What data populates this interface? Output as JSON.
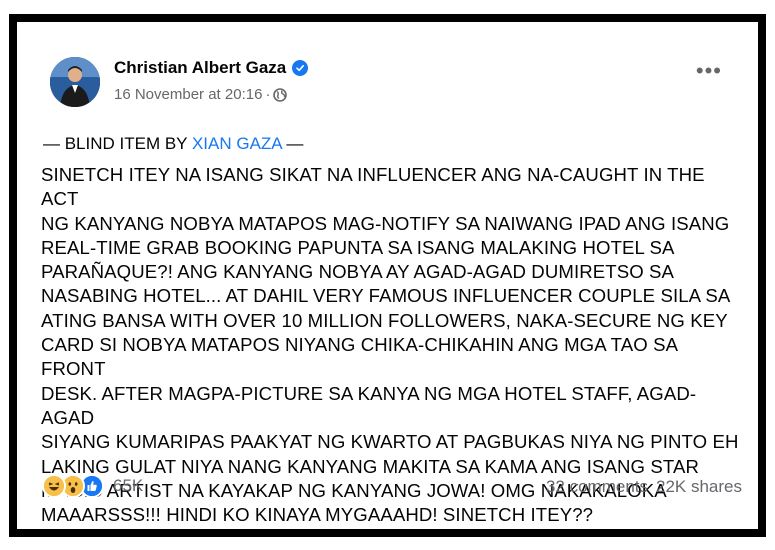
{
  "post": {
    "author": "Christian Albert Gaza",
    "timestamp": "16 November at 20:16",
    "separator": "·",
    "audience_icon": "globe-icon",
    "more_label": "•••",
    "blind_prefix": "— BLIND ITEM BY ",
    "blind_link": "XIAN GAZA",
    "blind_suffix": " —",
    "body_lines": [
      "SINETCH ITEY NA ISANG SIKAT NA INFLUENCER ANG NA-CAUGHT IN THE ACT",
      "NG KANYANG NOBYA MATAPOS MAG-NOTIFY SA NAIWANG IPAD ANG ISANG",
      "REAL-TIME GRAB BOOKING PAPUNTA SA ISANG MALAKING HOTEL SA",
      "PARAÑAQUE?! ANG KANYANG NOBYA AY AGAD-AGAD DUMIRETSO SA",
      "NASABING HOTEL... AT DAHIL VERY FAMOUS INFLUENCER COUPLE SILA SA",
      "ATING BANSA WITH OVER 10 MILLION FOLLOWERS, NAKA-SECURE NG KEY",
      "CARD SI NOBYA MATAPOS NIYANG CHIKA-CHIKAHIN ANG MGA TAO SA FRONT",
      "DESK. AFTER MAGPA-PICTURE SA KANYA NG MGA HOTEL STAFF, AGAD-AGAD",
      "SIYANG KUMARIPAS PAAKYAT NG KWARTO AT PAGBUKAS NIYA NG PINTO EH",
      "LAKING GULAT NIYA NANG KANYANG MAKITA SA KAMA ANG ISANG STAR",
      "MAGIC ARTIST NA KAYAKAP NG KANYANG JOWA! OMG NAKAKALOKA",
      "MAAARSSS!!! HINDI KO KINAYA MYGAAAHD! SINETCH ITEY??"
    ],
    "reaction_count": "65K",
    "comments": "32 comments",
    "shares": "22K shares",
    "colors": {
      "link": "#1877f2",
      "meta": "#65676b",
      "text": "#050505"
    }
  }
}
